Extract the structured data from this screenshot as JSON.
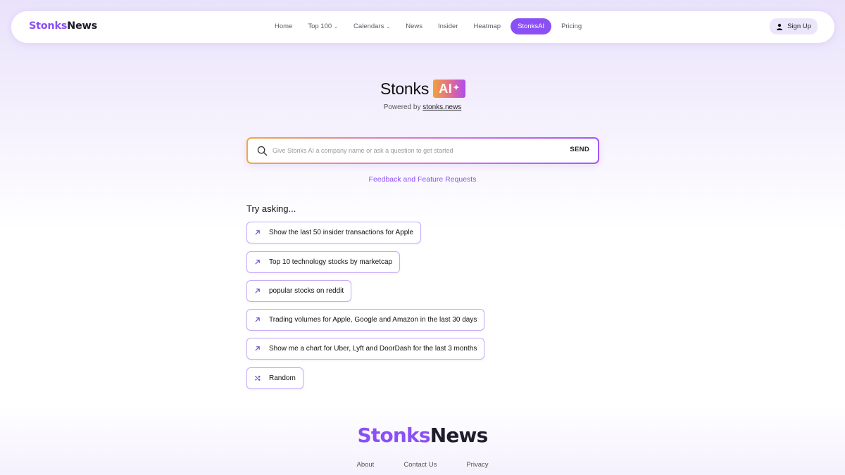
{
  "nav": {
    "logo_part1": "Stonks",
    "logo_part2": "News",
    "items": [
      {
        "label": "Home",
        "has_dropdown": false
      },
      {
        "label": "Top 100",
        "has_dropdown": true
      },
      {
        "label": "Calendars",
        "has_dropdown": true
      },
      {
        "label": "News",
        "has_dropdown": false
      },
      {
        "label": "Insider",
        "has_dropdown": false
      },
      {
        "label": "Heatmap",
        "has_dropdown": false
      },
      {
        "label": "StonksAI",
        "has_dropdown": false,
        "active": true
      },
      {
        "label": "Pricing",
        "has_dropdown": false
      }
    ],
    "signup_label": "Sign Up",
    "signup_icon": "user-icon"
  },
  "hero": {
    "title_word": "Stonks",
    "badge_text": "AI",
    "badge_spark": "✦",
    "powered_prefix": "Powered by",
    "powered_link": "stonks.news"
  },
  "search": {
    "placeholder": "Give Stonks AI a company name or ask a question to get started",
    "value": "",
    "send_label": "SEND"
  },
  "feedback_link": "Feedback and Feature Requests",
  "try_asking": {
    "title": "Try asking...",
    "suggestions": [
      {
        "label": "Show the last 50 insider transactions for Apple",
        "icon": "arrow-up-right-icon"
      },
      {
        "label": "Top 10 technology stocks by marketcap",
        "icon": "arrow-up-right-icon"
      },
      {
        "label": "popular stocks on reddit",
        "icon": "arrow-up-right-icon"
      },
      {
        "label": "Trading volumes for Apple, Google and Amazon in the last 30 days",
        "icon": "arrow-up-right-icon"
      },
      {
        "label": "Show me a chart for Uber, Lyft and DoorDash for the last 3 months",
        "icon": "arrow-up-right-icon"
      },
      {
        "label": "Random",
        "icon": "shuffle-icon"
      }
    ]
  },
  "footer": {
    "logo_part1": "Stonks",
    "logo_part2": "News",
    "links": [
      "About",
      "Contact Us",
      "Privacy"
    ]
  },
  "colors": {
    "accent": "#8b50f5",
    "badge_gradient_start": "#f0a13c",
    "badge_gradient_end": "#b04af0"
  }
}
